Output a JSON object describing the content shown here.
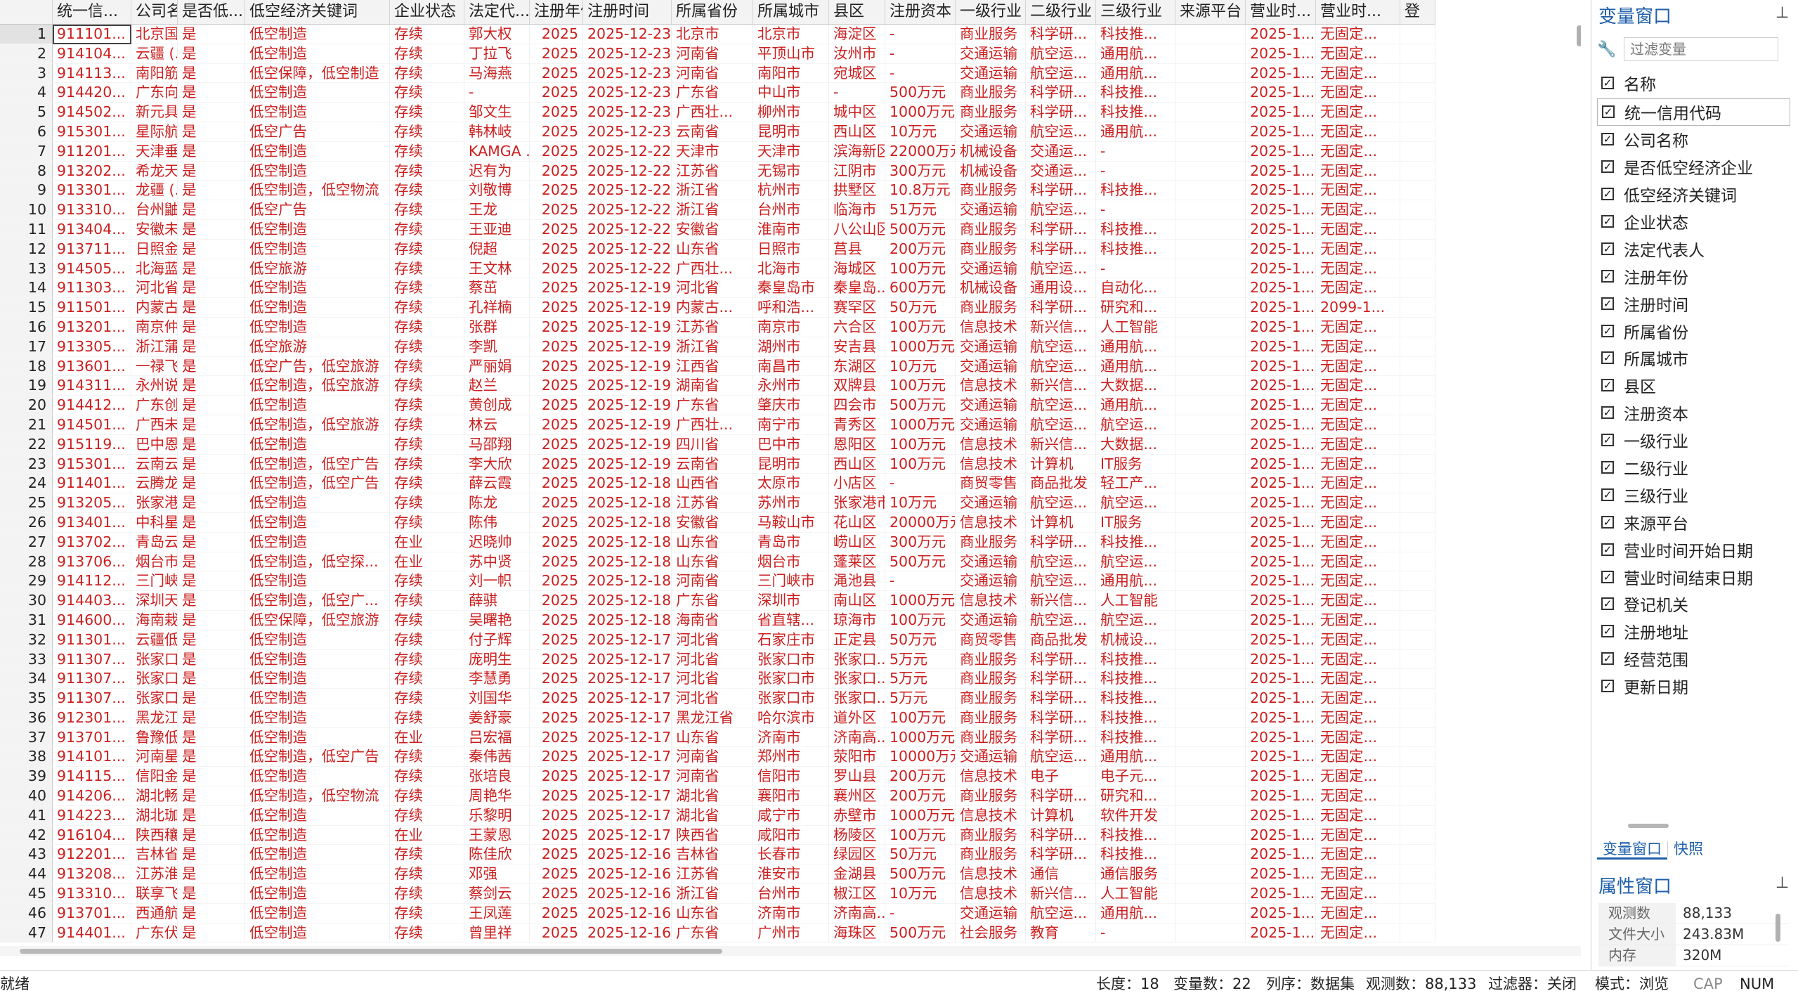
{
  "columns": [
    "统一信...",
    "公司名称",
    "是否低...",
    "低空经济关键词",
    "企业状态",
    "法定代...",
    "注册年份",
    "注册时间",
    "所属省份",
    "所属城市",
    "县区",
    "注册资本",
    "一级行业",
    "二级行业",
    "三级行业",
    "来源平台",
    "营业时...",
    "营业时...",
    "登"
  ],
  "rows": [
    [
      "911101...",
      "北京国...",
      "是",
      "低空制造",
      "存续",
      "郭大权",
      "2025",
      "2025-12-23",
      "北京市",
      "北京市",
      "海淀区",
      "-",
      "商业服务",
      "科学研...",
      "科技推...",
      "",
      "2025-1...",
      "无固定..."
    ],
    [
      "914104...",
      "云疆 (...",
      "是",
      "低空制造",
      "存续",
      "丁拉飞",
      "2025",
      "2025-12-23",
      "河南省",
      "平顶山市",
      "汝州市",
      "-",
      "交通运输",
      "航空运...",
      "通用航...",
      "",
      "2025-1...",
      "无固定..."
    ],
    [
      "914113...",
      "南阳筋...",
      "是",
      "低空保障，低空制造",
      "存续",
      "马海燕",
      "2025",
      "2025-12-23",
      "河南省",
      "南阳市",
      "宛城区",
      "-",
      "交通运输",
      "航空运...",
      "通用航...",
      "",
      "2025-1...",
      "无固定..."
    ],
    [
      "914420...",
      "广东向...",
      "是",
      "低空制造",
      "存续",
      "-",
      "2025",
      "2025-12-23",
      "广东省",
      "中山市",
      "-",
      "500万元",
      "商业服务",
      "科学研...",
      "科技推...",
      "",
      "2025-1...",
      "无固定..."
    ],
    [
      "914502...",
      "新元具...",
      "是",
      "低空制造",
      "存续",
      "邹文生",
      "2025",
      "2025-12-23",
      "广西壮...",
      "柳州市",
      "城中区",
      "1000万元",
      "商业服务",
      "科学研...",
      "科技推...",
      "",
      "2025-1...",
      "无固定..."
    ],
    [
      "915301...",
      "星际航...",
      "是",
      "低空广告",
      "存续",
      "韩林岐",
      "2025",
      "2025-12-23",
      "云南省",
      "昆明市",
      "西山区",
      "10万元",
      "交通运输",
      "航空运...",
      "通用航...",
      "",
      "2025-1...",
      "无固定..."
    ],
    [
      "911201...",
      "天津垂...",
      "是",
      "低空制造",
      "存续",
      "KAMGA ...",
      "2025",
      "2025-12-22",
      "天津市",
      "天津市",
      "滨海新区",
      "22000万元",
      "机械设备",
      "交通运...",
      "-",
      "",
      "2025-1...",
      "无固定..."
    ],
    [
      "913202...",
      "希龙天...",
      "是",
      "低空制造",
      "存续",
      "迟有为",
      "2025",
      "2025-12-22",
      "江苏省",
      "无锡市",
      "江阴市",
      "300万元",
      "机械设备",
      "交通运...",
      "-",
      "",
      "2025-1...",
      "无固定..."
    ],
    [
      "913301...",
      "龙疆 (...",
      "是",
      "低空制造，低空物流",
      "存续",
      "刘敬博",
      "2025",
      "2025-12-22",
      "浙江省",
      "杭州市",
      "拱墅区",
      "10.8万元",
      "商业服务",
      "科学研...",
      "科技推...",
      "",
      "2025-1...",
      "无固定..."
    ],
    [
      "913310...",
      "台州鼬...",
      "是",
      "低空广告",
      "存续",
      "王龙",
      "2025",
      "2025-12-22",
      "浙江省",
      "台州市",
      "临海市",
      "51万元",
      "交通运输",
      "航空运...",
      "-",
      "",
      "2025-1...",
      "无固定..."
    ],
    [
      "913404...",
      "安徽未...",
      "是",
      "低空制造",
      "存续",
      "王亚迪",
      "2025",
      "2025-12-22",
      "安徽省",
      "淮南市",
      "八公山区",
      "500万元",
      "商业服务",
      "科学研...",
      "科技推...",
      "",
      "2025-1...",
      "无固定..."
    ],
    [
      "913711...",
      "日照金...",
      "是",
      "低空制造",
      "存续",
      "倪超",
      "2025",
      "2025-12-22",
      "山东省",
      "日照市",
      "莒县",
      "200万元",
      "商业服务",
      "科学研...",
      "科技推...",
      "",
      "2025-1...",
      "无固定..."
    ],
    [
      "914505...",
      "北海蓝...",
      "是",
      "低空旅游",
      "存续",
      "王文林",
      "2025",
      "2025-12-22",
      "广西壮...",
      "北海市",
      "海城区",
      "100万元",
      "交通运输",
      "航空运...",
      "-",
      "",
      "2025-1...",
      "无固定..."
    ],
    [
      "911303...",
      "河北省...",
      "是",
      "低空制造",
      "存续",
      "蔡茁",
      "2025",
      "2025-12-19",
      "河北省",
      "秦皇岛市",
      "秦皇岛...",
      "600万元",
      "机械设备",
      "通用设...",
      "自动化...",
      "",
      "2025-1...",
      "无固定..."
    ],
    [
      "911501...",
      "内蒙古...",
      "是",
      "低空制造",
      "存续",
      "孔祥楠",
      "2025",
      "2025-12-19",
      "内蒙古...",
      "呼和浩...",
      "赛罕区",
      "50万元",
      "商业服务",
      "科学研...",
      "研究和...",
      "",
      "2025-1...",
      "2099-1..."
    ],
    [
      "913201...",
      "南京仲...",
      "是",
      "低空制造",
      "存续",
      "张群",
      "2025",
      "2025-12-19",
      "江苏省",
      "南京市",
      "六合区",
      "100万元",
      "信息技术",
      "新兴信...",
      "人工智能",
      "",
      "2025-1...",
      "无固定..."
    ],
    [
      "913305...",
      "浙江蒲...",
      "是",
      "低空旅游",
      "存续",
      "李凯",
      "2025",
      "2025-12-19",
      "浙江省",
      "湖州市",
      "安吉县",
      "1000万元",
      "交通运输",
      "航空运...",
      "通用航...",
      "",
      "2025-1...",
      "无固定..."
    ],
    [
      "913601...",
      "一禄飞...",
      "是",
      "低空广告，低空旅游",
      "存续",
      "严丽娟",
      "2025",
      "2025-12-19",
      "江西省",
      "南昌市",
      "东湖区",
      "10万元",
      "交通运输",
      "航空运...",
      "通用航...",
      "",
      "2025-1...",
      "无固定..."
    ],
    [
      "914311...",
      "永州说...",
      "是",
      "低空制造，低空旅游",
      "存续",
      "赵兰",
      "2025",
      "2025-12-19",
      "湖南省",
      "永州市",
      "双牌县",
      "100万元",
      "信息技术",
      "新兴信...",
      "大数据...",
      "",
      "2025-1...",
      "无固定..."
    ],
    [
      "914412...",
      "广东创...",
      "是",
      "低空制造",
      "存续",
      "黄创成",
      "2025",
      "2025-12-19",
      "广东省",
      "肇庆市",
      "四会市",
      "500万元",
      "交通运输",
      "航空运...",
      "通用航...",
      "",
      "2025-1...",
      "无固定..."
    ],
    [
      "914501...",
      "广西未...",
      "是",
      "低空制造，低空旅游",
      "存续",
      "林云",
      "2025",
      "2025-12-19",
      "广西壮...",
      "南宁市",
      "青秀区",
      "1000万元",
      "交通运输",
      "航空运...",
      "航空运...",
      "",
      "2025-1...",
      "无固定..."
    ],
    [
      "915119...",
      "巴中恩...",
      "是",
      "低空制造",
      "存续",
      "马邵翔",
      "2025",
      "2025-12-19",
      "四川省",
      "巴中市",
      "恩阳区",
      "100万元",
      "信息技术",
      "新兴信...",
      "大数据...",
      "",
      "2025-1...",
      "无固定..."
    ],
    [
      "915301...",
      "云南云...",
      "是",
      "低空制造，低空广告",
      "存续",
      "李大欣",
      "2025",
      "2025-12-19",
      "云南省",
      "昆明市",
      "西山区",
      "100万元",
      "信息技术",
      "计算机",
      "IT服务",
      "",
      "2025-1...",
      "无固定..."
    ],
    [
      "911401...",
      "云腾龙...",
      "是",
      "低空制造，低空广告",
      "存续",
      "薛云霞",
      "2025",
      "2025-12-18",
      "山西省",
      "太原市",
      "小店区",
      "-",
      "商贸零售",
      "商品批发",
      "轻工产...",
      "",
      "2025-1...",
      "无固定..."
    ],
    [
      "913205...",
      "张家港...",
      "是",
      "低空制造",
      "存续",
      "陈龙",
      "2025",
      "2025-12-18",
      "江苏省",
      "苏州市",
      "张家港市",
      "10万元",
      "交通运输",
      "航空运...",
      "航空运...",
      "",
      "2025-1...",
      "无固定..."
    ],
    [
      "913401...",
      "中科星...",
      "是",
      "低空制造",
      "存续",
      "陈伟",
      "2025",
      "2025-12-18",
      "安徽省",
      "马鞍山市",
      "花山区",
      "20000万元",
      "信息技术",
      "计算机",
      "IT服务",
      "",
      "2025-1...",
      "无固定..."
    ],
    [
      "913702...",
      "青岛云...",
      "是",
      "低空制造",
      "在业",
      "迟晓帅",
      "2025",
      "2025-12-18",
      "山东省",
      "青岛市",
      "崂山区",
      "300万元",
      "商业服务",
      "科学研...",
      "科技推...",
      "",
      "2025-1...",
      "无固定..."
    ],
    [
      "913706...",
      "烟台市...",
      "是",
      "低空制造，低空探...",
      "在业",
      "苏中贤",
      "2025",
      "2025-12-18",
      "山东省",
      "烟台市",
      "蓬莱区",
      "500万元",
      "交通运输",
      "航空运...",
      "航空运...",
      "",
      "2025-1...",
      "无固定..."
    ],
    [
      "914112...",
      "三门峡...",
      "是",
      "低空制造",
      "存续",
      "刘一帜",
      "2025",
      "2025-12-18",
      "河南省",
      "三门峡市",
      "渑池县",
      "-",
      "交通运输",
      "航空运...",
      "通用航...",
      "",
      "2025-1...",
      "无固定..."
    ],
    [
      "914403...",
      "深圳天...",
      "是",
      "低空制造，低空广...",
      "存续",
      "薛骐",
      "2025",
      "2025-12-18",
      "广东省",
      "深圳市",
      "南山区",
      "1000万元",
      "信息技术",
      "新兴信...",
      "人工智能",
      "",
      "2025-1...",
      "无固定..."
    ],
    [
      "914600...",
      "海南栽...",
      "是",
      "低空保障，低空旅游",
      "存续",
      "吴曙艳",
      "2025",
      "2025-12-18",
      "海南省",
      "省直辖...",
      "琼海市",
      "100万元",
      "交通运输",
      "航空运...",
      "航空运...",
      "",
      "2025-1...",
      "无固定..."
    ],
    [
      "911301...",
      "云疆低...",
      "是",
      "低空制造",
      "存续",
      "付子辉",
      "2025",
      "2025-12-17",
      "河北省",
      "石家庄市",
      "正定县",
      "50万元",
      "商贸零售",
      "商品批发",
      "机械设...",
      "",
      "2025-1...",
      "无固定..."
    ],
    [
      "911307...",
      "张家口...",
      "是",
      "低空制造",
      "存续",
      "庞明生",
      "2025",
      "2025-12-17",
      "河北省",
      "张家口市",
      "张家口...",
      "5万元",
      "商业服务",
      "科学研...",
      "科技推...",
      "",
      "2025-1...",
      "无固定..."
    ],
    [
      "911307...",
      "张家口...",
      "是",
      "低空制造",
      "存续",
      "李慧勇",
      "2025",
      "2025-12-17",
      "河北省",
      "张家口市",
      "张家口...",
      "5万元",
      "商业服务",
      "科学研...",
      "科技推...",
      "",
      "2025-1...",
      "无固定..."
    ],
    [
      "911307...",
      "张家口...",
      "是",
      "低空制造",
      "存续",
      "刘国华",
      "2025",
      "2025-12-17",
      "河北省",
      "张家口市",
      "张家口...",
      "5万元",
      "商业服务",
      "科学研...",
      "科技推...",
      "",
      "2025-1...",
      "无固定..."
    ],
    [
      "912301...",
      "黑龙江...",
      "是",
      "低空制造",
      "存续",
      "姜舒豪",
      "2025",
      "2025-12-17",
      "黑龙江省",
      "哈尔滨市",
      "道外区",
      "100万元",
      "商业服务",
      "科学研...",
      "科技推...",
      "",
      "2025-1...",
      "无固定..."
    ],
    [
      "913701...",
      "鲁豫低...",
      "是",
      "低空制造",
      "在业",
      "吕宏福",
      "2025",
      "2025-12-17",
      "山东省",
      "济南市",
      "济南高...",
      "1000万元",
      "商业服务",
      "科学研...",
      "科技推...",
      "",
      "2025-1...",
      "无固定..."
    ],
    [
      "914101...",
      "河南星...",
      "是",
      "低空制造，低空广告",
      "存续",
      "秦伟茜",
      "2025",
      "2025-12-17",
      "河南省",
      "郑州市",
      "荥阳市",
      "10000万元",
      "交通运输",
      "航空运...",
      "通用航...",
      "",
      "2025-1...",
      "无固定..."
    ],
    [
      "914115...",
      "信阳金...",
      "是",
      "低空制造",
      "存续",
      "张培良",
      "2025",
      "2025-12-17",
      "河南省",
      "信阳市",
      "罗山县",
      "200万元",
      "信息技术",
      "电子",
      "电子元...",
      "",
      "2025-1...",
      "无固定..."
    ],
    [
      "914206...",
      "湖北畅...",
      "是",
      "低空制造，低空物流",
      "存续",
      "周艳华",
      "2025",
      "2025-12-17",
      "湖北省",
      "襄阳市",
      "襄州区",
      "200万元",
      "商业服务",
      "科学研...",
      "研究和...",
      "",
      "2025-1...",
      "无固定..."
    ],
    [
      "914223...",
      "湖北珈...",
      "是",
      "低空制造",
      "存续",
      "乐黎明",
      "2025",
      "2025-12-17",
      "湖北省",
      "咸宁市",
      "赤壁市",
      "1000万元",
      "信息技术",
      "计算机",
      "软件开发",
      "",
      "2025-1...",
      "无固定..."
    ],
    [
      "916104...",
      "陕西穰...",
      "是",
      "低空制造",
      "在业",
      "王蒙恩",
      "2025",
      "2025-12-17",
      "陕西省",
      "咸阳市",
      "杨陵区",
      "100万元",
      "商业服务",
      "科学研...",
      "科技推...",
      "",
      "2025-1...",
      "无固定..."
    ],
    [
      "912201...",
      "吉林省...",
      "是",
      "低空制造",
      "存续",
      "陈佳欣",
      "2025",
      "2025-12-16",
      "吉林省",
      "长春市",
      "绿园区",
      "50万元",
      "商业服务",
      "科学研...",
      "科技推...",
      "",
      "2025-1...",
      "无固定..."
    ],
    [
      "913208...",
      "江苏淮...",
      "是",
      "低空制造",
      "存续",
      "邓强",
      "2025",
      "2025-12-16",
      "江苏省",
      "淮安市",
      "金湖县",
      "500万元",
      "信息技术",
      "通信",
      "通信服务",
      "",
      "2025-1...",
      "无固定..."
    ],
    [
      "913310...",
      "联享飞...",
      "是",
      "低空制造",
      "存续",
      "蔡剑云",
      "2025",
      "2025-12-16",
      "浙江省",
      "台州市",
      "椒江区",
      "10万元",
      "信息技术",
      "新兴信...",
      "人工智能",
      "",
      "2025-1...",
      "无固定..."
    ],
    [
      "913701...",
      "西通航...",
      "是",
      "低空制造",
      "存续",
      "王凤莲",
      "2025",
      "2025-12-16",
      "山东省",
      "济南市",
      "济南高...",
      "-",
      "交通运输",
      "航空运...",
      "通用航...",
      "",
      "2025-1...",
      "无固定..."
    ],
    [
      "914401...",
      "广东伏...",
      "是",
      "低空制造",
      "存续",
      "曾里祥",
      "2025",
      "2025-12-16",
      "广东省",
      "广州市",
      "海珠区",
      "500万元",
      "社会服务",
      "教育",
      "-",
      "",
      "2025-1...",
      "无固定..."
    ]
  ],
  "var_panel": {
    "title": "变量窗口",
    "pin": "📌",
    "filter_placeholder": "过滤变量",
    "header": "名称",
    "items": [
      "统一信用代码",
      "公司名称",
      "是否低空经济企业",
      "低空经济关键词",
      "企业状态",
      "法定代表人",
      "注册年份",
      "注册时间",
      "所属省份",
      "所属城市",
      "县区",
      "注册资本",
      "一级行业",
      "二级行业",
      "三级行业",
      "来源平台",
      "营业时间开始日期",
      "营业时间结束日期",
      "登记机关",
      "注册地址",
      "经营范围",
      "更新日期"
    ],
    "tabs": [
      "变量窗口",
      "快照"
    ]
  },
  "prop_panel": {
    "title": "属性窗口",
    "rows": [
      {
        "k": "观测数",
        "v": "88,133"
      },
      {
        "k": "文件大小",
        "v": "243.83M"
      },
      {
        "k": "内存",
        "v": "320M"
      }
    ]
  },
  "status": {
    "ready": "就绪",
    "length": "长度：18",
    "vars": "变量数：22",
    "order": "列序：数据集",
    "obs": "观测数：88,133",
    "filter": "过滤器：关闭",
    "mode": "模式：浏览",
    "cap": "CAP",
    "num": "NUM"
  },
  "colors": {
    "cell_text": "#cc1f1f",
    "accent": "#1f5fa8"
  }
}
